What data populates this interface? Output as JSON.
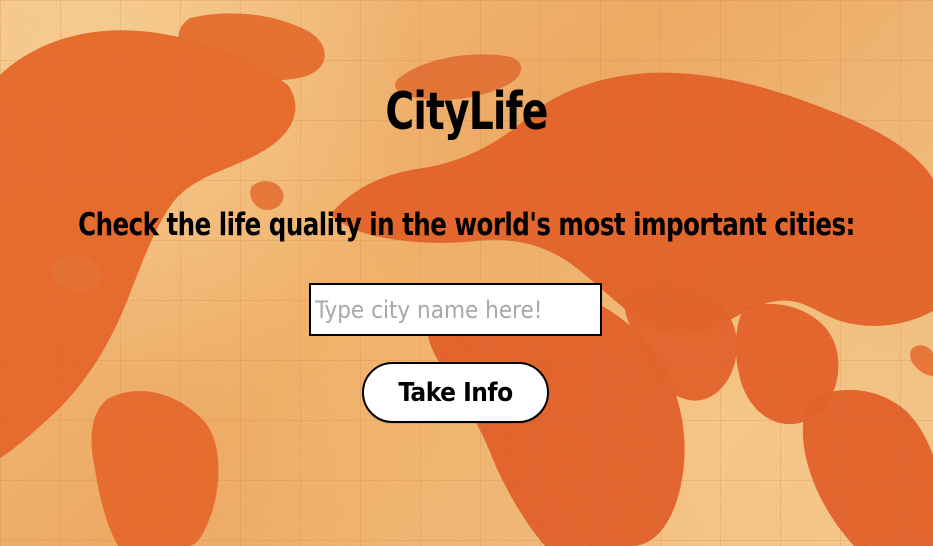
{
  "app": {
    "title": "CityLife",
    "subtitle": "Check the life quality in the world's most important cities:",
    "search": {
      "value": "",
      "placeholder": "Type city name here!"
    },
    "button_label": "Take Info"
  },
  "theme": {
    "background": "#f3b36a",
    "continent_color": "#e75a22",
    "text_color": "#000000",
    "input_background": "#ffffff"
  },
  "background": {
    "icon": "world-map-background"
  }
}
